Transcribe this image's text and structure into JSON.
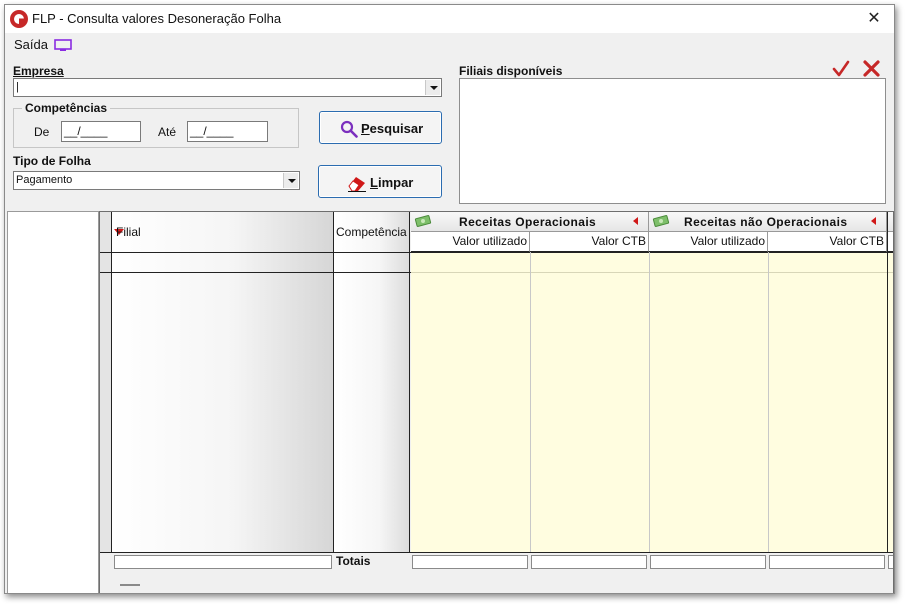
{
  "window": {
    "title": "FLP - Consulta valores Desoneração Folha",
    "close_glyph": "✕"
  },
  "menu": {
    "saida": "Saída"
  },
  "empresa": {
    "label": "Empresa",
    "value": "|"
  },
  "competencias": {
    "group_title": "Competências",
    "de_label": "De",
    "de_value": "__/____",
    "ate_label": "Até",
    "ate_value": "__/____"
  },
  "tipo_folha": {
    "label": "Tipo de Folha",
    "value": "Pagamento"
  },
  "buttons": {
    "pesquisar_u": "P",
    "pesquisar_rest": "esquisar",
    "limpar_u": "L",
    "limpar_rest": "impar"
  },
  "filiais": {
    "label": "Filiais disponíveis"
  },
  "grid": {
    "col_filial": "Filial",
    "col_competencia": "Competência",
    "groups": [
      {
        "label": "Receitas Operacionais"
      },
      {
        "label": "Receitas não Operacionais"
      }
    ],
    "sub_headers": [
      "Valor utilizado",
      "Valor CTB",
      "Valor utilizado",
      "Valor CTB"
    ],
    "totals_label": "Totais"
  },
  "colors": {
    "accent_blue": "#2b6cb0",
    "grid_yellow": "#fffde0",
    "red": "#d01818",
    "purple": "#8a2be2"
  }
}
